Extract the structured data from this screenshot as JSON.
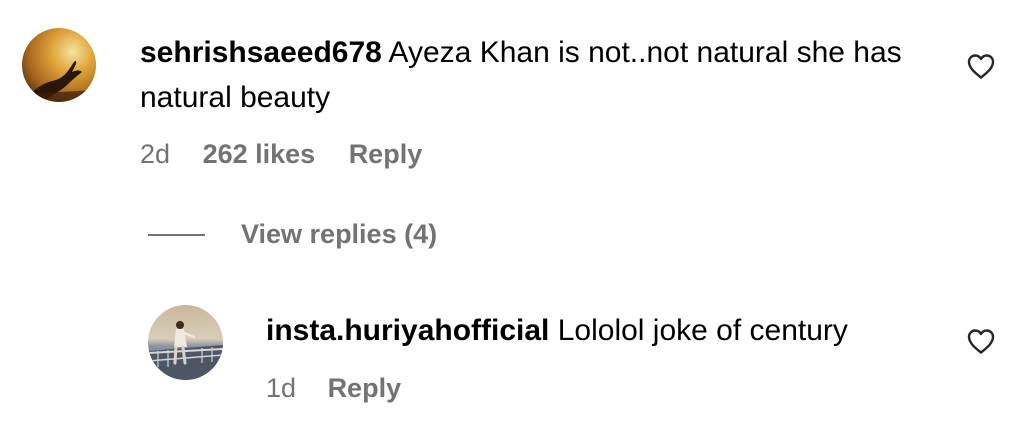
{
  "comments": [
    {
      "username": "sehrishsaeed678",
      "text": "Ayeza Khan is not..not natural she has natural beauty",
      "age": "2d",
      "likes": "262 likes",
      "reply_label": "Reply",
      "avatar_icon": "sunset-hand-avatar-icon"
    }
  ],
  "view_replies": {
    "label": "View replies (4)"
  },
  "replies": [
    {
      "username": "insta.huriyahofficial",
      "text": "Lololol joke of century",
      "age": "1d",
      "reply_label": "Reply",
      "avatar_icon": "woman-on-boat-avatar-icon"
    }
  ],
  "colors": {
    "text": "#000000",
    "secondary": "#737373",
    "background": "#ffffff"
  },
  "icons": {
    "like": "heart-outline-icon"
  }
}
